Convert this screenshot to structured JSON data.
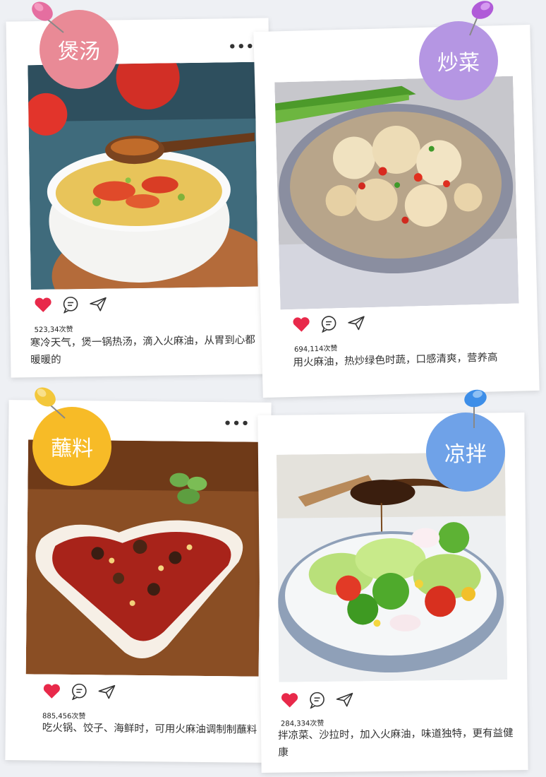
{
  "cards": [
    {
      "badge": "煲汤",
      "badge_color": "#e98a96",
      "likes": "523,34次赞",
      "caption": "寒冷天气，煲一锅热汤，滴入火麻油，从胃到心都暖暖的",
      "menu": "•••"
    },
    {
      "badge": "炒菜",
      "badge_color": "#b596e3",
      "likes": "694,114次赞",
      "caption": "用火麻油，热炒绿色时蔬，口感清爽，营养高"
    },
    {
      "badge": "蘸料",
      "badge_color": "#f7bb27",
      "likes": "885,456次赞",
      "caption": "吃火锅、饺子、海鲜时，可用火麻油调制制蘸料",
      "menu": "•••"
    },
    {
      "badge": "凉拌",
      "badge_color": "#6fa2e8",
      "likes": "284,334次赞",
      "caption": "拌凉菜、沙拉时，加入火麻油，味道独特，更有益健康"
    }
  ],
  "icons": {
    "like": "heart-icon",
    "comment": "comment-icon",
    "share": "share-icon",
    "pin": "pushpin-icon"
  }
}
